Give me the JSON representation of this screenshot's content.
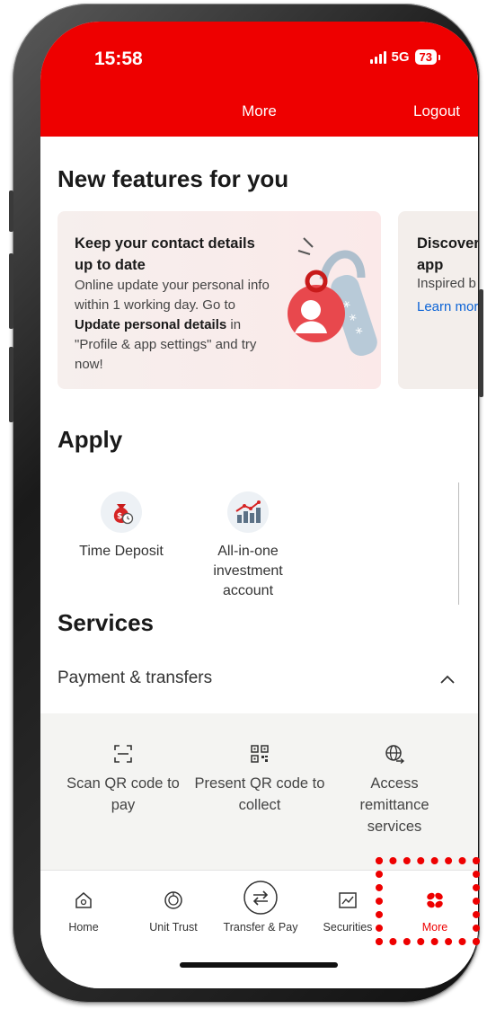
{
  "status_bar": {
    "time": "15:58",
    "network": "5G",
    "battery": "73"
  },
  "header": {
    "title": "More",
    "logout_label": "Logout"
  },
  "new_features": {
    "heading": "New features for you",
    "cards": [
      {
        "title": "Keep your contact details up to date",
        "body_start": "Online update your personal info within 1 working day. Go to ",
        "body_bold": "Update personal details",
        "body_end": " in \"Profile & app settings\" and try now!"
      },
      {
        "title": "Discover\napp",
        "subtitle": "Inspired b",
        "link": "Learn mor"
      }
    ]
  },
  "apply": {
    "heading": "Apply",
    "items": [
      {
        "label": "Time Deposit",
        "icon": "money-bag-icon"
      },
      {
        "label": "All-in-one investment account",
        "icon": "bar-chart-growth-icon"
      }
    ]
  },
  "services": {
    "heading": "Services",
    "section": "Payment & transfers",
    "items": [
      {
        "label": "Scan QR code to pay",
        "icon": "scan-qr-icon"
      },
      {
        "label": "Present QR code to collect",
        "icon": "qr-code-icon"
      },
      {
        "label": "Access remittance services",
        "icon": "globe-transfer-icon"
      }
    ]
  },
  "bottom_nav": {
    "items": [
      {
        "label": "Home",
        "icon": "home-icon"
      },
      {
        "label": "Unit Trust",
        "icon": "unit-trust-icon"
      },
      {
        "label": "Transfer & Pay",
        "icon": "transfer-icon"
      },
      {
        "label": "Securities",
        "icon": "securities-chart-icon"
      },
      {
        "label": "More",
        "icon": "more-dots-icon",
        "active": true
      }
    ]
  },
  "colors": {
    "brand_red": "#ee0000",
    "link_blue": "#0b63d6",
    "highlight_dotted": "#ee0000"
  }
}
